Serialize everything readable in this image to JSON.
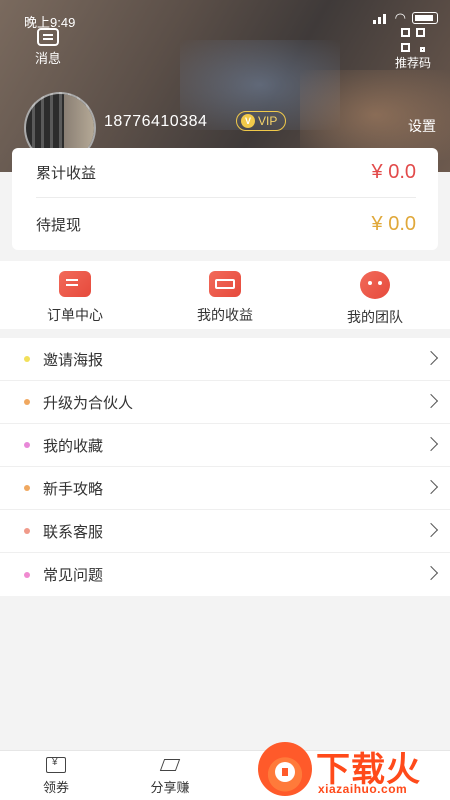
{
  "status_bar": {
    "time": "晚上9:49"
  },
  "header": {
    "message_label": "消息",
    "qr_label": "推荐码",
    "phone": "18776410384",
    "vip_badge": "VIP",
    "settings_label": "设置"
  },
  "earnings": {
    "total_label": "累计收益",
    "total_value": "¥ 0.0",
    "pending_label": "待提现",
    "pending_value": "¥ 0.0"
  },
  "quick_actions": [
    {
      "label": "订单中心",
      "icon": "order-icon"
    },
    {
      "label": "我的收益",
      "icon": "wallet-icon"
    },
    {
      "label": "我的团队",
      "icon": "team-icon"
    }
  ],
  "menu": [
    {
      "label": "邀请海报",
      "dot_color": "#f2e05a"
    },
    {
      "label": "升级为合伙人",
      "dot_color": "#f0a860"
    },
    {
      "label": "我的收藏",
      "dot_color": "#e888d8"
    },
    {
      "label": "新手攻略",
      "dot_color": "#f0a860"
    },
    {
      "label": "联系客服",
      "dot_color": "#f09a8a"
    },
    {
      "label": "常见问题",
      "dot_color": "#f08ad0"
    }
  ],
  "tab_bar": [
    {
      "label": "领券",
      "icon": "coupon-icon"
    },
    {
      "label": "分享赚",
      "icon": "paper-plane-icon"
    }
  ],
  "watermark": {
    "title": "下载火",
    "subtitle": "xiazaihuo.com"
  },
  "colors": {
    "value_red": "#e24a4a",
    "value_gold": "#e0a83a",
    "accent": "#e64a3c"
  }
}
